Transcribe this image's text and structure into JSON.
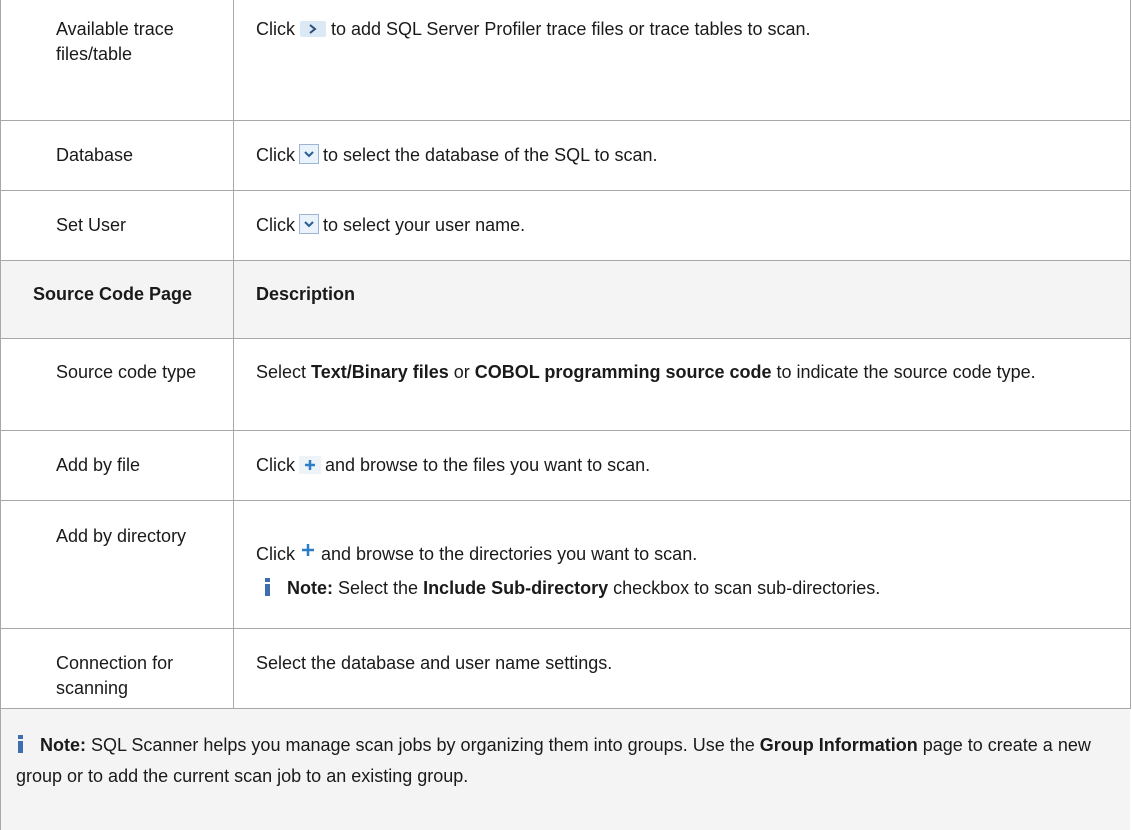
{
  "rows": [
    {
      "label": "Available trace files/table",
      "pre": "Click",
      "post": "to add SQL Server Profiler trace files or trace tables to scan."
    },
    {
      "label": "Database",
      "pre": "Click",
      "post": "to select the database of the SQL to scan."
    },
    {
      "label": "Set User",
      "pre": "Click",
      "post": "to select your user name."
    }
  ],
  "header": {
    "left": "Source Code Page",
    "right": "Description"
  },
  "source_type": {
    "label": "Source code type",
    "t1": "Select ",
    "b1": "Text/Binary files",
    "t2": " or ",
    "b2": "COBOL programming source code",
    "t3": " to indicate the source code type."
  },
  "add_file": {
    "label": "Add by file",
    "pre": "Click",
    "post": "and browse to the files you want to scan."
  },
  "add_dir": {
    "label": "Add by directory",
    "pre": "Click",
    "post": "and browse to the directories you want to scan.",
    "note_label": "Note:",
    "note_t1": " Select the ",
    "note_b1": "Include Sub-directory",
    "note_t2": " checkbox to scan sub-directories."
  },
  "connection": {
    "label": "Connection for scanning",
    "text": "Select the database and user name settings."
  },
  "footer_note": {
    "label": "Note:",
    "t1": " SQL Scanner helps you manage scan jobs by organizing them into groups. Use the ",
    "b1": "Group Information",
    "t2": " page to create a new group or to add the current scan job to an existing group."
  },
  "icons": [
    "chevron-right-icon",
    "dropdown-arrow-icon",
    "plus-icon",
    "info-icon"
  ]
}
